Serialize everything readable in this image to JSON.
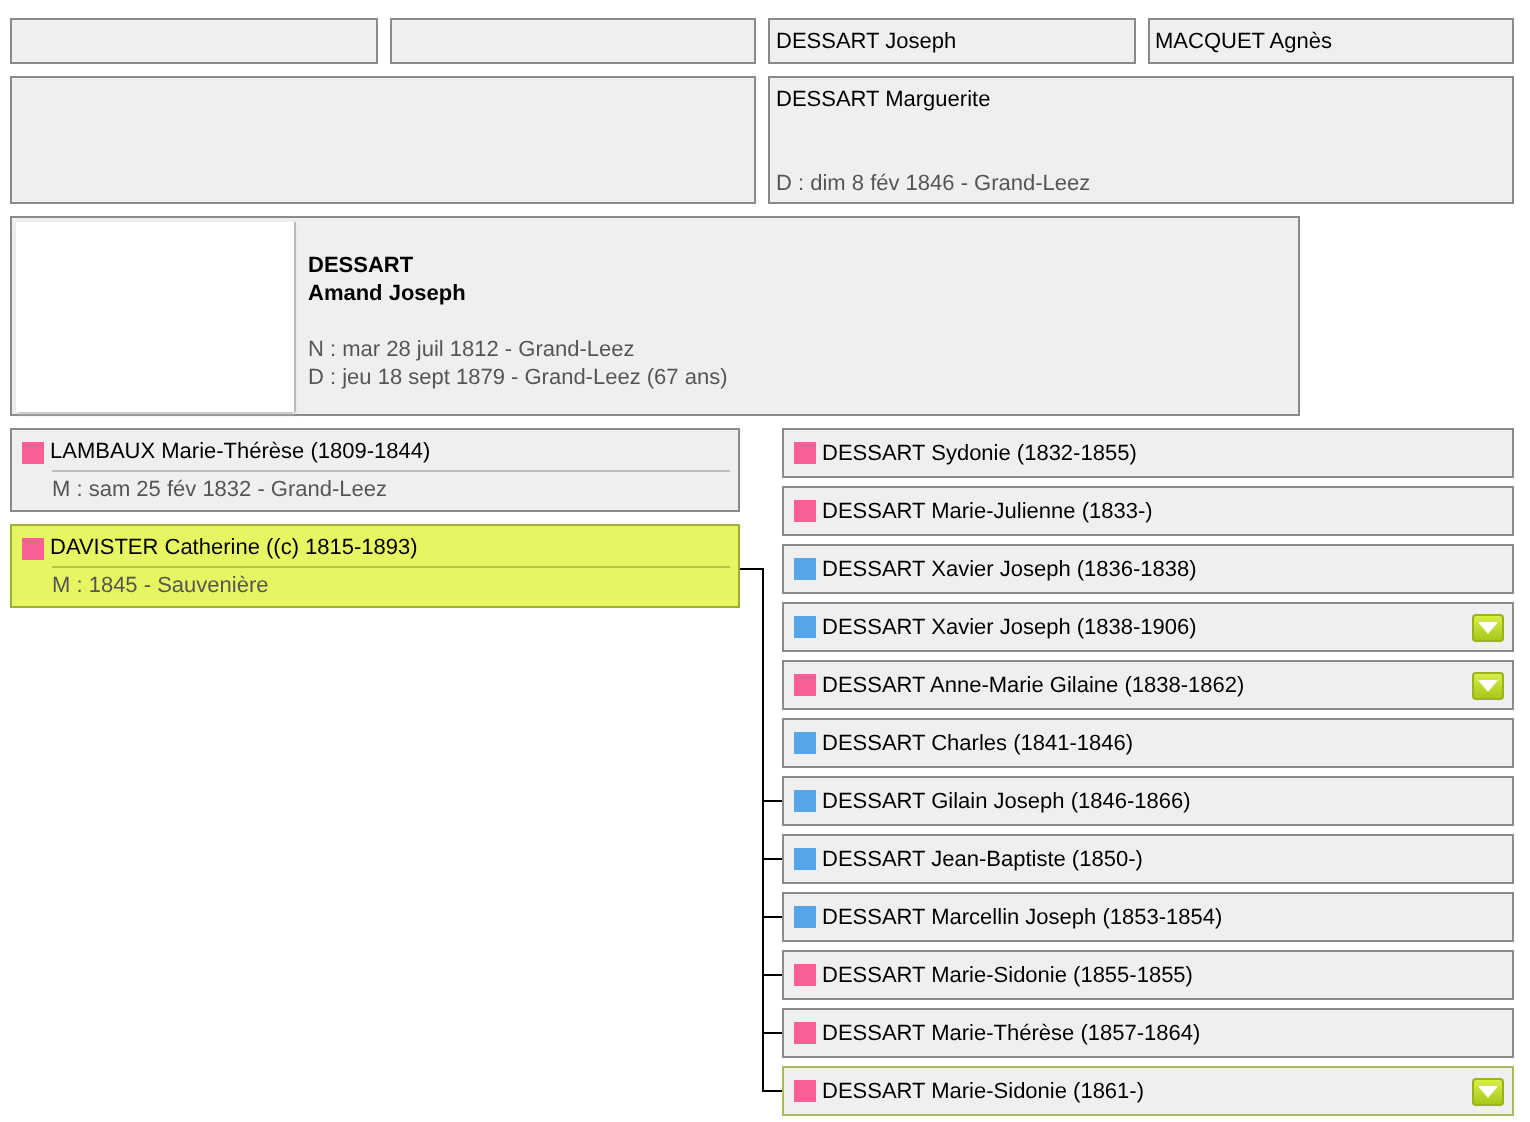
{
  "grandparents": [
    {
      "kind": "empty"
    },
    {
      "kind": "empty"
    },
    {
      "kind": "person",
      "name": "DESSART Joseph"
    },
    {
      "kind": "person",
      "name": "MACQUET Agnès"
    }
  ],
  "parents": [
    {
      "kind": "empty"
    },
    {
      "kind": "person",
      "name": "DESSART Marguerite",
      "death": "D : dim 8 fév 1846 - Grand-Leez"
    }
  ],
  "person": {
    "surname": "DESSART",
    "given_names": "Amand Joseph",
    "birth": "N : mar 28 juil 1812 - Grand-Leez",
    "death": "D : jeu 18 sept 1879 - Grand-Leez (67 ans)"
  },
  "spouses": [
    {
      "name": "LAMBAUX Marie-Thérèse (1809-1844)",
      "marriage": "M : sam 25 fév 1832 - Grand-Leez",
      "color": "#f95e96",
      "selected": false
    },
    {
      "name": "DAVISTER Catherine ((c) 1815-1893)",
      "marriage": "M : 1845 - Sauvenière",
      "color": "#f95e96",
      "selected": true
    }
  ],
  "children": [
    {
      "name": "DESSART Sydonie (1832-1855)",
      "color": "#f95e96",
      "linked": false,
      "expandable": false,
      "selected": false
    },
    {
      "name": "DESSART Marie-Julienne (1833-)",
      "color": "#f95e96",
      "linked": false,
      "expandable": false,
      "selected": false
    },
    {
      "name": "DESSART Xavier Joseph (1836-1838)",
      "color": "#56a5e9",
      "linked": false,
      "expandable": false,
      "selected": false
    },
    {
      "name": "DESSART Xavier Joseph (1838-1906)",
      "color": "#56a5e9",
      "linked": false,
      "expandable": true,
      "selected": false
    },
    {
      "name": "DESSART Anne-Marie Gilaine (1838-1862)",
      "color": "#f95e96",
      "linked": false,
      "expandable": true,
      "selected": false
    },
    {
      "name": "DESSART Charles (1841-1846)",
      "color": "#56a5e9",
      "linked": false,
      "expandable": false,
      "selected": false
    },
    {
      "name": "DESSART Gilain Joseph (1846-1866)",
      "color": "#56a5e9",
      "linked": true,
      "expandable": false,
      "selected": false
    },
    {
      "name": "DESSART Jean-Baptiste (1850-)",
      "color": "#56a5e9",
      "linked": true,
      "expandable": false,
      "selected": false
    },
    {
      "name": "DESSART Marcellin Joseph (1853-1854)",
      "color": "#56a5e9",
      "linked": true,
      "expandable": false,
      "selected": false
    },
    {
      "name": "DESSART Marie-Sidonie (1855-1855)",
      "color": "#f95e96",
      "linked": true,
      "expandable": false,
      "selected": false
    },
    {
      "name": "DESSART Marie-Thérèse (1857-1864)",
      "color": "#f95e96",
      "linked": true,
      "expandable": false,
      "selected": false
    },
    {
      "name": "DESSART Marie-Sidonie (1861-)",
      "color": "#f95e96",
      "linked": true,
      "expandable": true,
      "selected": true
    }
  ]
}
